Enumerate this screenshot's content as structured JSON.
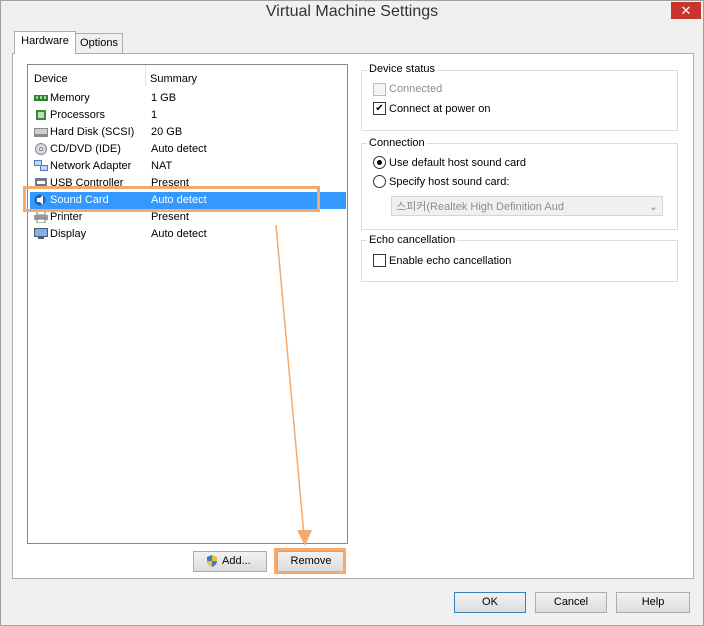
{
  "window": {
    "title": "Virtual Machine Settings",
    "close_glyph": "✕"
  },
  "tabs": [
    {
      "label": "Hardware"
    },
    {
      "label": "Options"
    }
  ],
  "device_list": {
    "header_device": "Device",
    "header_summary": "Summary",
    "rows": [
      {
        "name": "Memory",
        "summary": "1 GB",
        "icon": "memory-icon"
      },
      {
        "name": "Processors",
        "summary": "1",
        "icon": "processor-icon"
      },
      {
        "name": "Hard Disk (SCSI)",
        "summary": "20 GB",
        "icon": "hard-disk-icon"
      },
      {
        "name": "CD/DVD (IDE)",
        "summary": "Auto detect",
        "icon": "cd-dvd-icon"
      },
      {
        "name": "Network Adapter",
        "summary": "NAT",
        "icon": "network-adapter-icon"
      },
      {
        "name": "USB Controller",
        "summary": "Present",
        "icon": "usb-controller-icon"
      },
      {
        "name": "Sound Card",
        "summary": "Auto detect",
        "icon": "sound-card-icon",
        "selected": true
      },
      {
        "name": "Printer",
        "summary": "Present",
        "icon": "printer-icon"
      },
      {
        "name": "Display",
        "summary": "Auto detect",
        "icon": "display-icon"
      }
    ]
  },
  "buttons": {
    "add": "Add...",
    "remove": "Remove",
    "ok": "OK",
    "cancel": "Cancel",
    "help": "Help"
  },
  "device_status": {
    "title": "Device status",
    "connected": {
      "label": "Connected",
      "checked": false,
      "disabled": true
    },
    "connect_at_power_on": {
      "label": "Connect at power on",
      "checked": true
    }
  },
  "connection": {
    "title": "Connection",
    "use_default": {
      "label": "Use default host sound card",
      "selected": true
    },
    "specify": {
      "label": "Specify host sound card:",
      "selected": false
    },
    "host_card_value": "스피커(Realtek High Definition Aud",
    "dropdown_arrow": "⌄"
  },
  "echo": {
    "title": "Echo cancellation",
    "enable": {
      "label": "Enable echo cancellation",
      "checked": false
    }
  },
  "colors": {
    "selection": "#3399ff",
    "highlight": "#f6a96b",
    "close": "#c7362b"
  }
}
